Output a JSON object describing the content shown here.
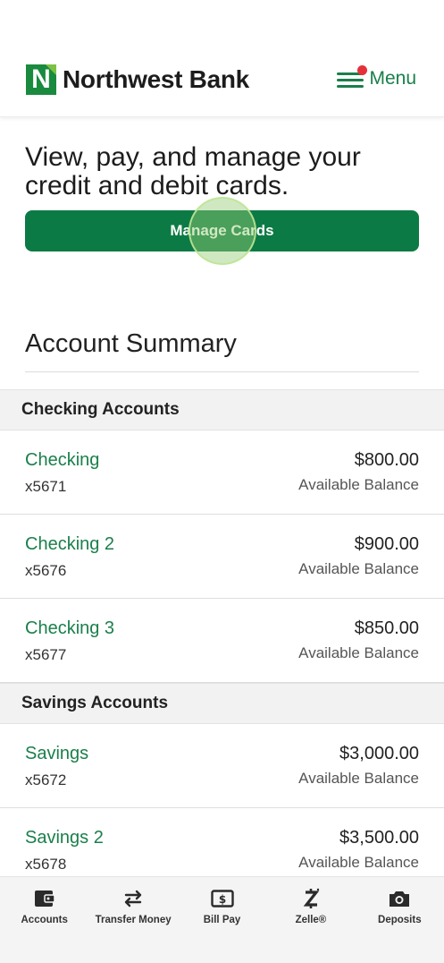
{
  "header": {
    "brand_name": "Northwest Bank",
    "brand_letter": "N",
    "menu_label": "Menu",
    "brand_color": "#1a8a3e",
    "accent_color": "#1a7f4b",
    "notification_color": "#e5303a"
  },
  "promo": {
    "text": "View, pay, and manage your credit and debit cards.",
    "button_label": "Manage Cards",
    "button_color": "#0c7a44"
  },
  "summary": {
    "title": "Account Summary"
  },
  "sections": [
    {
      "title": "Checking Accounts",
      "accounts": [
        {
          "name": "Checking",
          "number": "x5671",
          "balance": "$800.00",
          "balance_label": "Available Balance"
        },
        {
          "name": "Checking 2",
          "number": "x5676",
          "balance": "$900.00",
          "balance_label": "Available Balance"
        },
        {
          "name": "Checking 3",
          "number": "x5677",
          "balance": "$850.00",
          "balance_label": "Available Balance"
        }
      ]
    },
    {
      "title": "Savings Accounts",
      "accounts": [
        {
          "name": "Savings",
          "number": "x5672",
          "balance": "$3,000.00",
          "balance_label": "Available Balance"
        },
        {
          "name": "Savings 2",
          "number": "x5678",
          "balance": "$3,500.00",
          "balance_label": "Available Balance"
        }
      ]
    }
  ],
  "tabbar": {
    "items": [
      {
        "label": "Accounts",
        "icon": "wallet-icon"
      },
      {
        "label": "Transfer Money",
        "icon": "transfer-arrows-icon"
      },
      {
        "label": "Bill Pay",
        "icon": "bill-dollar-icon"
      },
      {
        "label": "Zelle®",
        "icon": "zelle-icon"
      },
      {
        "label": "Deposits",
        "icon": "camera-icon"
      }
    ]
  }
}
